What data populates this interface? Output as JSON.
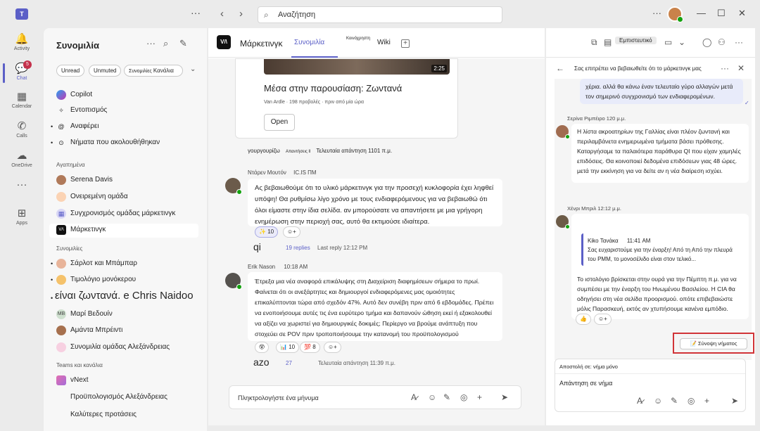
{
  "titlebar": {
    "logo_text": "T",
    "search_placeholder": "Αναζήτηση",
    "dots": "···"
  },
  "rail": {
    "items": [
      {
        "label": "Activity",
        "icon": "bell-icon",
        "glyph": "🔔"
      },
      {
        "label": "Chat",
        "icon": "chat-icon",
        "glyph": "💬",
        "badge": "5"
      },
      {
        "label": "Calendar",
        "icon": "calendar-icon",
        "glyph": "▦"
      },
      {
        "label": "Calls",
        "icon": "phone-icon",
        "glyph": "✆"
      },
      {
        "label": "OneDrive",
        "icon": "cloud-icon",
        "glyph": "☁"
      },
      {
        "label": "",
        "icon": "more-icon",
        "glyph": "···"
      },
      {
        "label": "Apps",
        "icon": "apps-icon",
        "glyph": "⊞"
      }
    ]
  },
  "left": {
    "title": "Συνομιλία",
    "filters": [
      "Unread",
      "Unmuted",
      "Συνομιλίες",
      "Κανάλια"
    ],
    "pinned": [
      {
        "label": "Copilot",
        "icon": "copilot-icon"
      },
      {
        "label": "Εντοπισμός",
        "icon": "sparkle-icon"
      },
      {
        "label": "Αναφέρει",
        "icon": "at-icon"
      },
      {
        "label": "Νήματα που ακολουθήθηκαν",
        "icon": "thread-icon"
      }
    ],
    "favorites_header": "Αγαπημένα",
    "favorites": [
      {
        "label": "Serena Davis"
      },
      {
        "label": "Ονειρεμένη ομάδα"
      },
      {
        "label": "Συγχρονισμός ομάδας μάρκετινγκ"
      },
      {
        "label": "Μάρκετινγκ"
      }
    ],
    "chats_header": "Συνομιλίες",
    "chats": [
      {
        "label": "Σάρλοτ και Μπάμπαρ"
      },
      {
        "label": "Τιμολόγιο μονόκερου"
      },
      {
        "label": "είναι ζωντανά. e Chris Naidoo"
      },
      {
        "label": "Μαρί Βεδουίν"
      },
      {
        "label": "Αμάντα Μπρέιντι"
      },
      {
        "label": "Συνομιλία ομάδας Αλεξάνδρειας"
      }
    ],
    "teams_header": "Teams και κανάλια",
    "teams": [
      {
        "label": "vNext"
      },
      {
        "label": "Προϋπολογισμός Αλεξάνδρειας"
      },
      {
        "label": "Καλύτερες προτάσεις"
      }
    ]
  },
  "main": {
    "channel_logo": "V/\\",
    "channel_name": "Μάρκετινγκ",
    "tabs": [
      "Συνομιλία",
      "Κοινόχρηστη",
      "Wiki"
    ],
    "card": {
      "duration": "2:25",
      "title": "Μέσα στην παρουσίαση: Ζωντανά",
      "meta": "Van Ardle · 198 προβολές · πριν από μία ώρα",
      "open": "Open"
    },
    "card_reply": {
      "who": "γουργουρίζω",
      "small": "Απαντήσεις ll",
      "last": "Τελευταία απάντηση 1101 π.μ."
    },
    "msg1": {
      "author": "Ντάρεν Μουτόν",
      "time": "IC.IS ΠΜ",
      "text": "Ας βεβαιωθούμε ότι το υλικό μάρκετινγκ για την προσεχή κυκλοφορία έχει ληφθεί υπόψη! Θα ρυθμίσω λίγο χρόνο με τους ενδιαφερόμενους για να βεβαιωθώ ότι όλοι είμαστε στην ίδια σελίδα. αν μπορούσατε να απαντήσετε με μια γρήγορη ενημέρωση στην περιοχή σας, αυτό θα εκτιμούσε ιδιαίτερα.",
      "react_count": "10",
      "reply_word": "qi",
      "replies": "19 replies",
      "last": "Last reply 12:12 PM"
    },
    "msg2": {
      "author": "Erik Nason",
      "time": "10:18 AM",
      "text": "Έτρεξα μια νέα αναφορά επικάλυψης στη Διαχείριση διαφημίσεων σήμερα το πρωί. Φαίνεται ότι οι ανεξάρτητες και δημιουργοί ενδιαφερόμενες μας ομοιότητες επικαλύπτονται τώρα από σχεδόν 47%. Αυτό δεν συνέβη πριν από 6 εβδομάδες. Πρέπει να ενοποιήσουμε αυτές τις ένα ευρύτερο τμήμα και δαπανούν ώθηση εκεί ή εξακολουθεί να αξίζει να χωριστεί για δημιουργικές δοκιμές; Περίεργο να βρούμε ανάπτυξη που στοχεύει σε POV πριν τροποποιήσουμε την κατανομή του προϋπολογισμού",
      "react2": "10",
      "react3": "8",
      "reply_word": "azo",
      "replies": "27",
      "last": "Τελευταία απάντηση 11:39 π.μ."
    },
    "compose_placeholder": "Πληκτρολογήστε ένα μήνυμα"
  },
  "right": {
    "pill": "Εμπιστευτικό",
    "thread_title": "Σας επιτρέπει να βεβαιωθείτε ότι το μάρκετινγκ μας",
    "top_bubble": "χέρια. αλλά θα κάνω έναν τελευταίο γύρο αλλαγών μετά τον σημερινό συγχρονισμό των ενδιαφερομένων.",
    "m1": {
      "author": "Σερίνα Ριμπέιρο 120 μ.μ.",
      "text": "Η λίστα ακροατηρίων της Γαλλίας είναι πλέον ζωντανή και περιλαμβάνετα ενημερωμένα τμήματα βάσει πρόθεσης. Καταργήσαμε τα παλαιότερα παράθυρα QI που είχαν χαμηλές επιδόσεις. Θα κοινοποιεί δεδομένα επιδόσεων γιας 48 ώρες. μετά την εκκίνηση για να δείτε αν η νέα διαίρεση ισχύει."
    },
    "m2": {
      "author": "Χένρι Μπριλ 12:12 μ.μ.",
      "quote_author": "Kiko Τανάκα",
      "quote_time": "11:41 AM",
      "quote_text": "Σας ευχαριστούμε για την έναρξη! Από τη Από την πλευρά του PMM, το μονοσέλιδο είναι στον τελικό...",
      "text": "Το ιστολόγιο βρίσκεται στην ουρά για την Πέμπτη π.μ. για να συμπέσει με την έναρξη του Ηνωμένου Βασιλείου. Η CIA θα οδηγήσει στη νέα σελίδα προορισμού. οπότε επιβεβαιώστε μόλις Παρασκευή, εκτός αν χτυπήσουμε κανένα εμπόδιο."
    },
    "summary": "Σύνοψη νήματος",
    "compose_to": "Αποστολή σε: νήμα μόνο",
    "compose_placeholder": "Απάντηση σε νήμα"
  }
}
